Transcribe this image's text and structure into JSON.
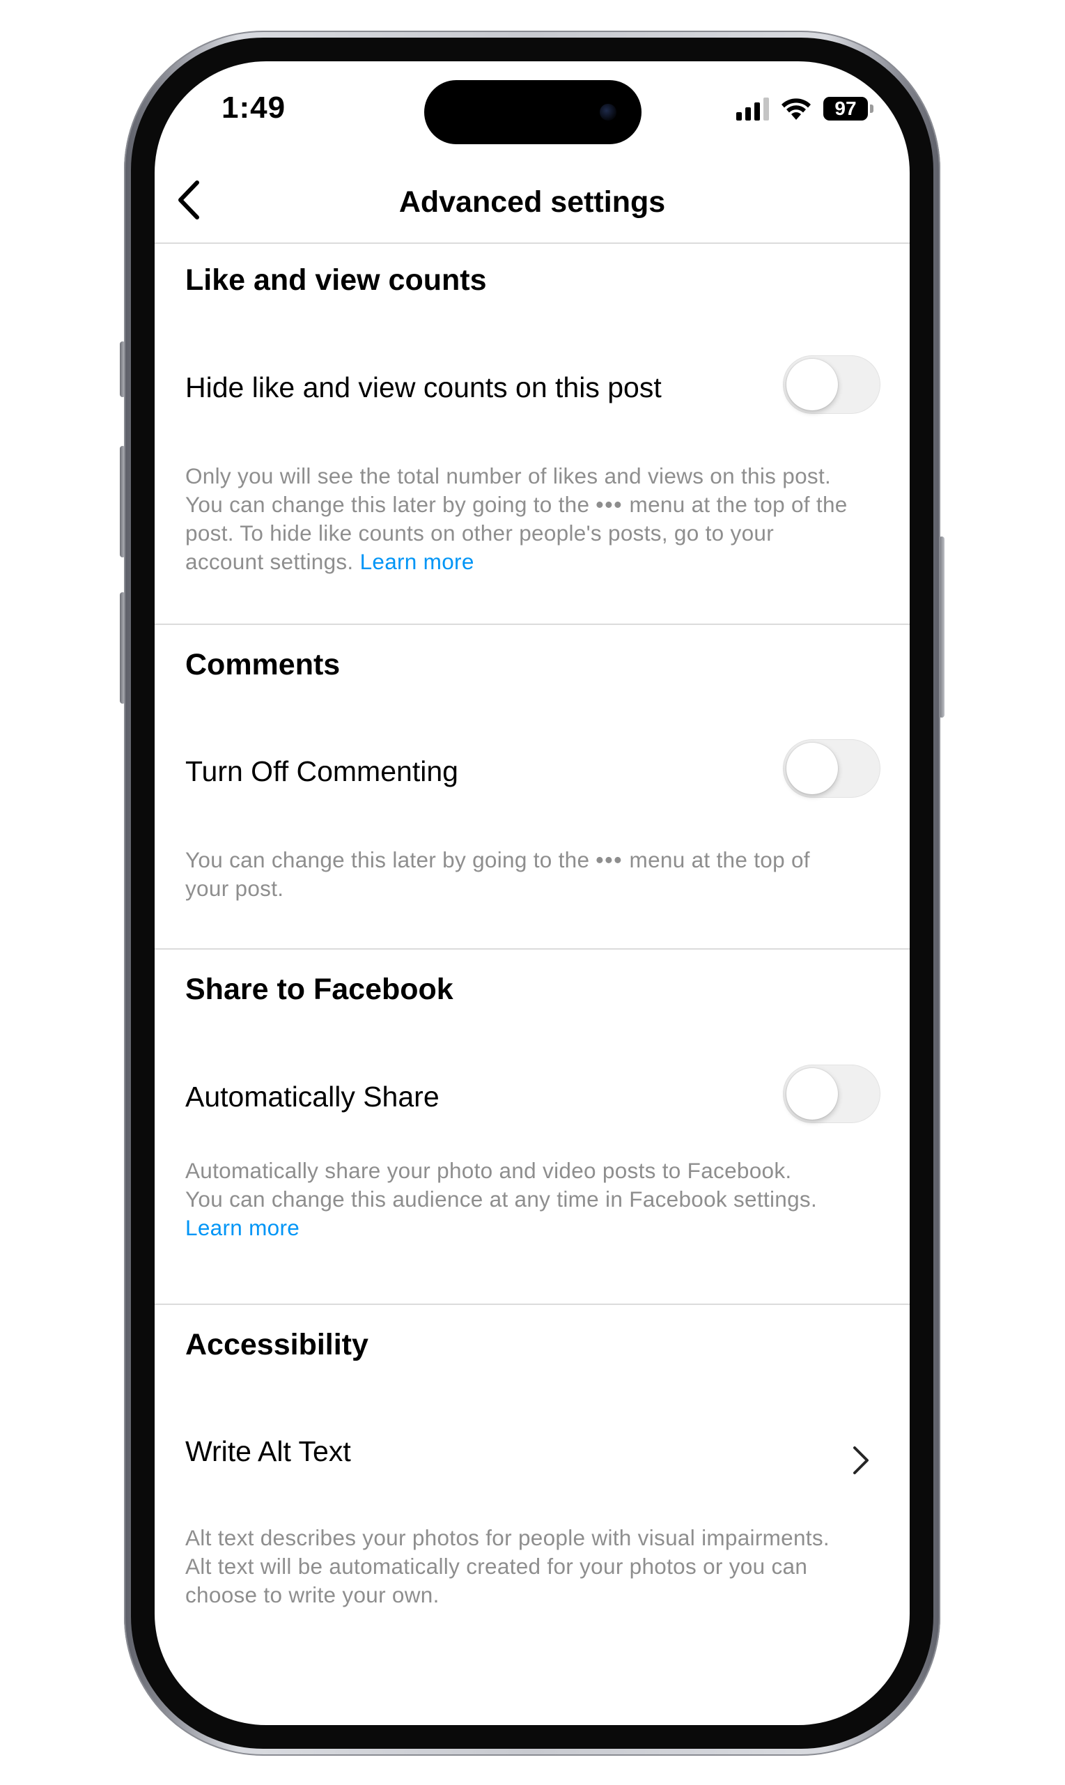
{
  "status_bar": {
    "time": "1:49",
    "battery": "97"
  },
  "header": {
    "title": "Advanced settings"
  },
  "sections": {
    "likes": {
      "title": "Like and view counts",
      "row_label": "Hide like and view counts on this post",
      "toggle_on": false,
      "desc_line1": "Only you will see the total number of likes and views on this post.",
      "desc_line2a": "You can change this later by going to the",
      "dots": "•••",
      "desc_line2b": "menu at the top of the",
      "desc_line3": "post. To hide like counts on other people's posts, go to your",
      "desc_line4": "account settings.",
      "link": "Learn more"
    },
    "comments": {
      "title": "Comments",
      "row_label": "Turn Off Commenting",
      "toggle_on": false,
      "desc_line1a": "You can change this later by going to the",
      "dots": "•••",
      "desc_line1b": "menu at the top of",
      "desc_line2": "your post."
    },
    "facebook": {
      "title": "Share to Facebook",
      "row_label": "Automatically Share",
      "toggle_on": false,
      "desc_line1": "Automatically share your photo and video posts to Facebook.",
      "desc_line2": "You can change this audience at any time in Facebook settings.",
      "link": "Learn more"
    },
    "accessibility": {
      "title": "Accessibility",
      "row_label": "Write Alt Text",
      "desc_line1": "Alt text describes your photos for people with visual impairments.",
      "desc_line2": "Alt text will be automatically created for your photos or you can",
      "desc_line3": "choose to write your own."
    }
  },
  "colors": {
    "link": "#0095f6",
    "secondary_text": "#8e8e8e",
    "divider": "#dbdbdb",
    "toggle_off": "#f0f0f0"
  }
}
